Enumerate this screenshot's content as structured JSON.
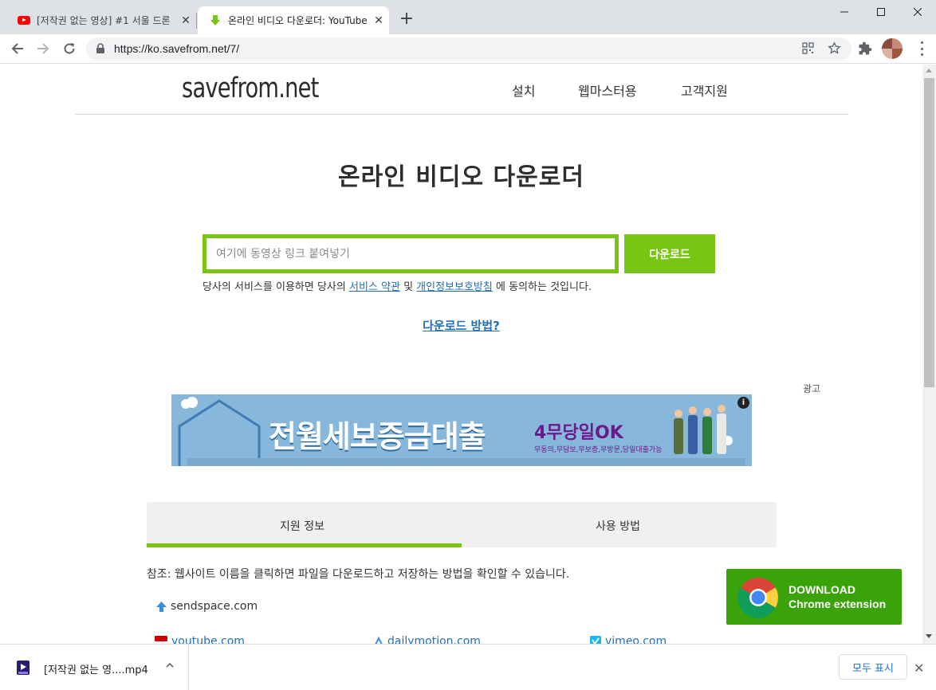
{
  "browser": {
    "tabs": [
      {
        "title": "[저작권 없는 영상] #1 서울 드론"
      },
      {
        "title": "온라인 비디오 다운로더: YouTube"
      }
    ],
    "url": "https://ko.savefrom.net/7/",
    "icons": {
      "back": "back-arrow-icon",
      "forward": "forward-arrow-icon",
      "reload": "reload-icon",
      "lock": "lock-icon",
      "qr": "qr-code-icon",
      "star": "bookmark-star-icon",
      "extensions": "puzzle-piece-icon",
      "menu": "three-dots-icon"
    }
  },
  "header": {
    "logo": "savefrom.net",
    "nav": [
      "설치",
      "웹마스터용",
      "고객지원"
    ]
  },
  "main": {
    "title": "온라인 비디오 다운로더",
    "input_placeholder": "여기에 동영상 링크 붙여넣기",
    "download_label": "다운로드",
    "terms_prefix": "당사의 서비스를 이용하면 당사의",
    "terms_link1": "서비스 약관",
    "terms_mid": "및",
    "terms_link2": "개인정보보호방침",
    "terms_suffix": "에 동의하는 것입니다.",
    "howto": "다운로드 방법?",
    "accent_color": "#7ac414",
    "link_color": "#1f6fb8"
  },
  "ad": {
    "label": "광고",
    "headline": "전월세보증금대출",
    "badge": "4무당일OK",
    "subtext": "무동의,무담보,무보증,무방문,당일대출가능",
    "info": "i"
  },
  "info_tabs": {
    "tab1": "지원 정보",
    "tab2": "사용 방법"
  },
  "note": "참조: 웹사이트 이름을 클릭하면 파일을 다운로드하고 저장하는 방법을 확인할 수 있습니다.",
  "sites": [
    "sendspace.com",
    "youtube.com",
    "dailymotion.com",
    "vimeo.com"
  ],
  "chrome_ext": {
    "line1": "DOWNLOAD",
    "line2": "Chrome extension"
  },
  "download_shelf": {
    "file_name": "[저작권 없는 영....mp4",
    "show_all": "모두 표시"
  }
}
